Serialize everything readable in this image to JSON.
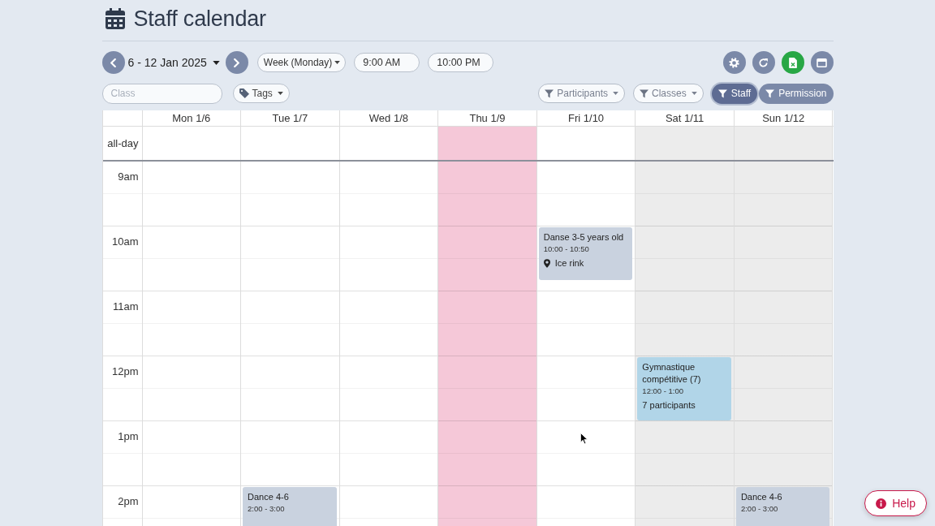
{
  "header": {
    "title": "Staff calendar"
  },
  "toolbar": {
    "date_range": "6 - 12 Jan 2025",
    "view": "Week (Monday)",
    "start_time": "9:00 AM",
    "end_time": "10:00 PM"
  },
  "filters": {
    "class_search": {
      "placeholder": "Class"
    },
    "tags": {
      "label": "Tags"
    },
    "dropdowns": [
      {
        "label": "Participants"
      },
      {
        "label": "Classes"
      }
    ],
    "toggles": [
      {
        "label": "Staff",
        "selected": true
      },
      {
        "label": "Permission",
        "selected": false
      }
    ]
  },
  "calendar": {
    "all_day_label": "all-day",
    "hours": [
      "9am",
      "10am",
      "11am",
      "12pm",
      "1pm",
      "2pm"
    ],
    "days": [
      {
        "label": "Mon 1/6",
        "today": false,
        "weekend": false
      },
      {
        "label": "Tue 1/7",
        "today": false,
        "weekend": false,
        "events": [
          {
            "title": "Dance 4-6",
            "time": "2:00 - 3:00",
            "color": "#c9d2df"
          }
        ]
      },
      {
        "label": "Wed 1/8",
        "today": false,
        "weekend": false
      },
      {
        "label": "Thu 1/9",
        "today": true,
        "weekend": false
      },
      {
        "label": "Fri 1/10",
        "today": false,
        "weekend": false,
        "events": [
          {
            "title": "Danse 3-5 years old",
            "time": "10:00 - 10:50",
            "location": "Ice rink",
            "color": "#c9d2df"
          }
        ]
      },
      {
        "label": "Sat 1/11",
        "today": false,
        "weekend": true,
        "events": [
          {
            "title": "Gymnastique compétitive (7)",
            "time": "12:00 - 1:00",
            "participants": "7 participants",
            "color": "#b1d5e8"
          }
        ]
      },
      {
        "label": "Sun 1/12",
        "today": false,
        "weekend": true,
        "events": [
          {
            "title": "Dance 4-6",
            "time": "2:00 - 3:00",
            "color": "#c9d2df"
          }
        ]
      }
    ]
  },
  "help_button": {
    "label": "Help"
  }
}
